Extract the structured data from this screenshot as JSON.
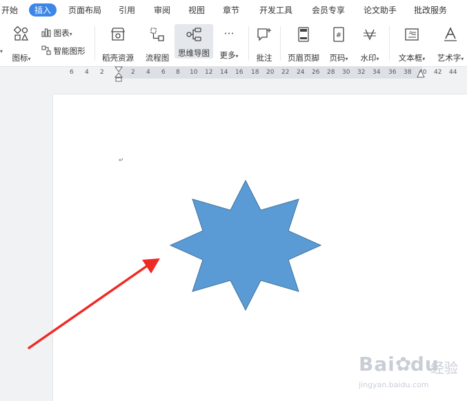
{
  "menu": {
    "items": [
      "开始",
      "插入",
      "页面布局",
      "引用",
      "审阅",
      "视图",
      "章节",
      "开发工具",
      "会员专享",
      "论文助手",
      "批改服务"
    ],
    "active": "插入"
  },
  "toolbar": {
    "icon_label": "图标",
    "chart_label": "图表",
    "smart_label": "智能图形",
    "resource_label": "稻壳资源",
    "flowchart_label": "流程图",
    "mindmap_label": "思维导图",
    "more_label": "更多",
    "comment_label": "批注",
    "header_footer_label": "页眉页脚",
    "page_num_label": "页码",
    "watermark_label": "水印",
    "textbox_label": "文本框",
    "wordart_label": "艺术字"
  },
  "ruler": {
    "left_numbers": [
      "6",
      "4",
      "2"
    ],
    "right_numbers": [
      "2",
      "4",
      "6",
      "8",
      "10",
      "12",
      "14",
      "16",
      "18",
      "20",
      "22",
      "24",
      "26",
      "28",
      "30",
      "32",
      "34",
      "36",
      "38",
      "40",
      "42",
      "44"
    ]
  },
  "document": {
    "paragraph_mark": "↵",
    "star_color": "#5b9bd5",
    "star_outline": "#41719c",
    "arrow_color": "#ee2a24"
  },
  "watermark": {
    "brand_text": "Bai",
    "brand_text2": "du",
    "cn_text": "经验",
    "url": "jingyan.baidu.com"
  }
}
